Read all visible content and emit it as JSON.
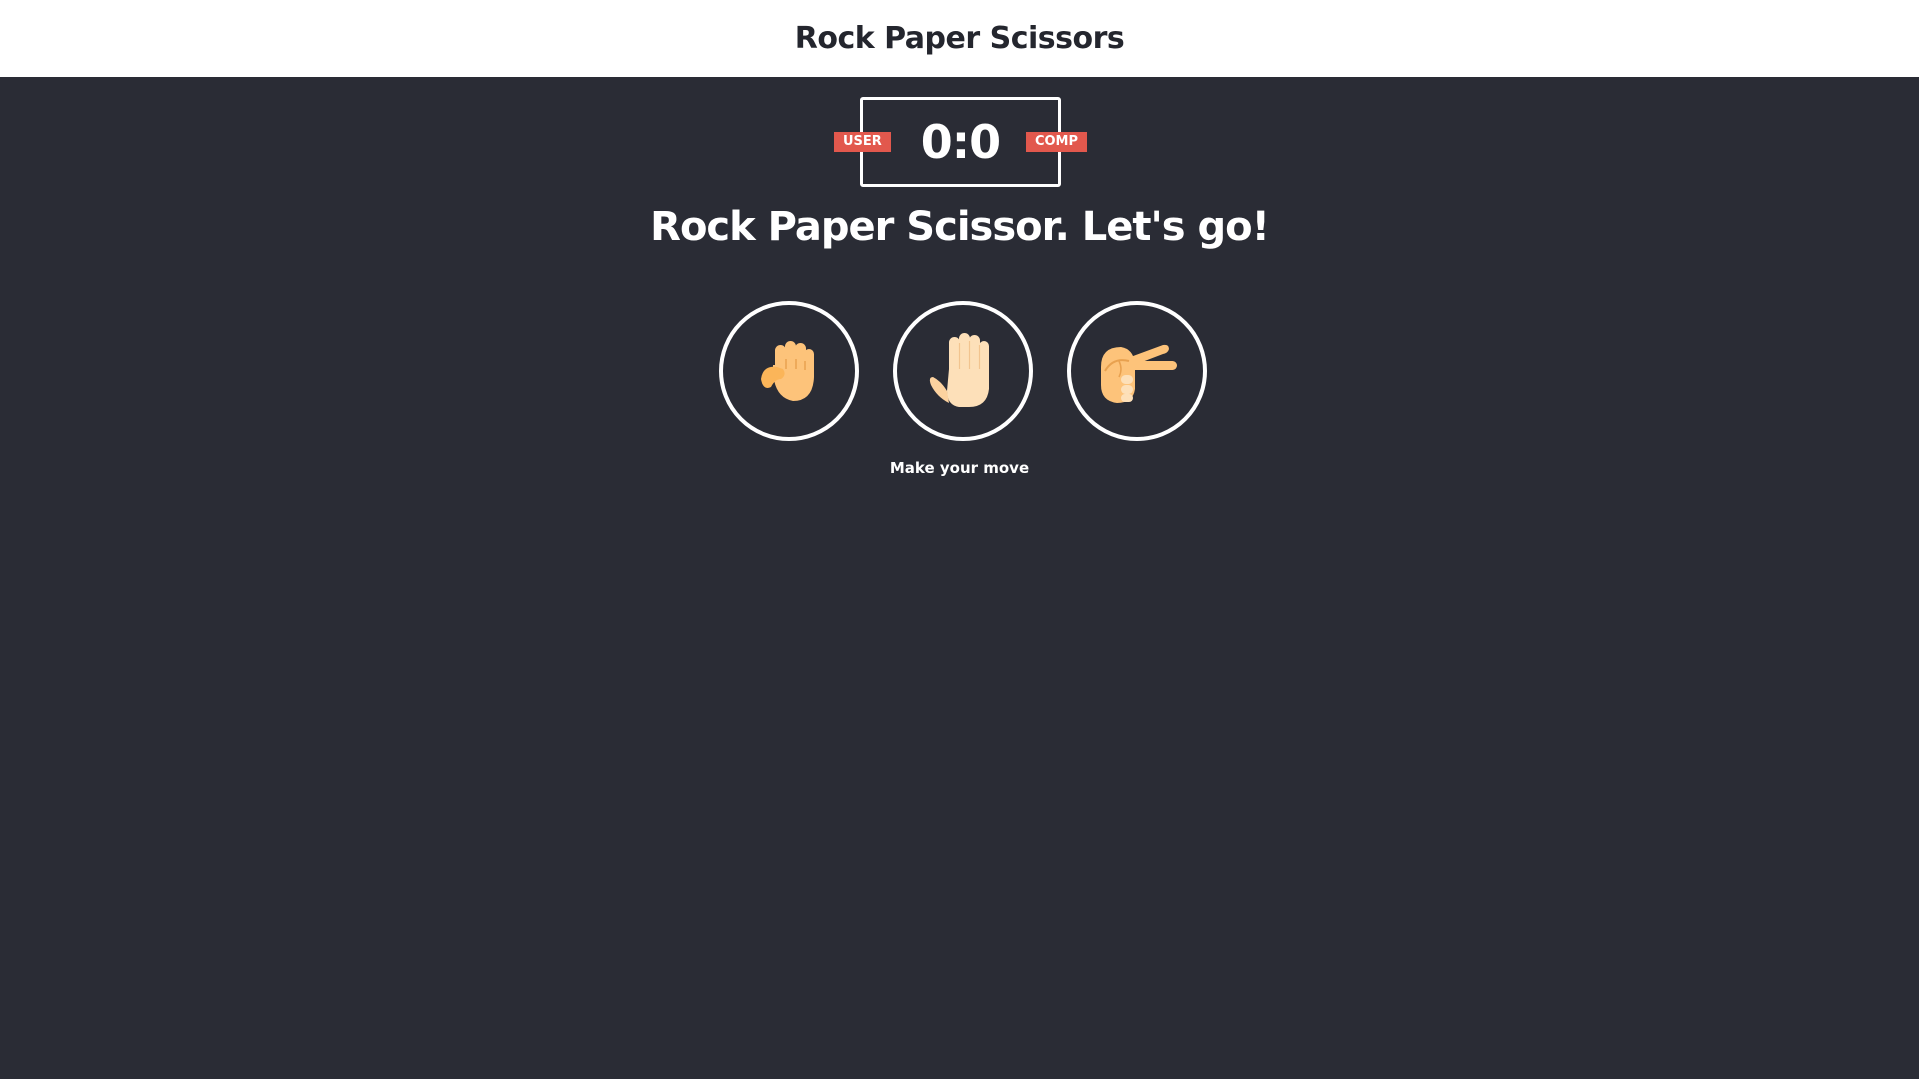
{
  "header": {
    "title": "Rock Paper Scissors"
  },
  "scoreboard": {
    "user_label": "USER",
    "comp_label": "COMP",
    "score": "0:0"
  },
  "main": {
    "headline": "Rock Paper Scissor. Let's go!",
    "prompt": "Make your move",
    "choices": [
      {
        "id": "rock",
        "icon": "fist-icon"
      },
      {
        "id": "paper",
        "icon": "open-hand-icon"
      },
      {
        "id": "scissors",
        "icon": "scissors-hand-icon"
      }
    ]
  },
  "colors": {
    "background": "#2a2c35",
    "header_background": "#ffffff",
    "badge": "#e2584d",
    "skin": "#fdc37a",
    "skin_light": "#fde0b9",
    "border": "#ffffff"
  }
}
